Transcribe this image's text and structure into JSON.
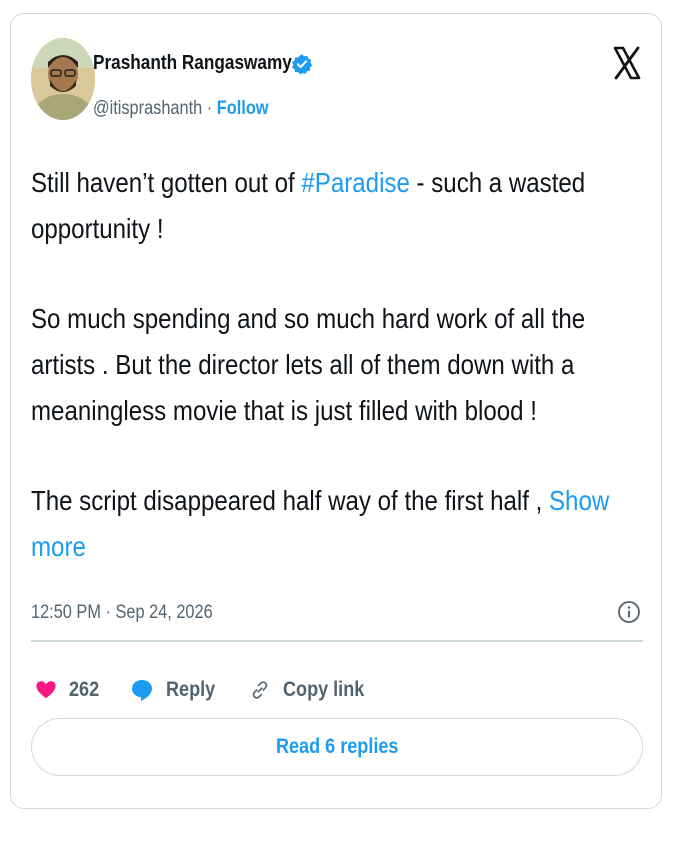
{
  "author": {
    "name": "Prashanth Rangaswamy",
    "handle": "@itisprashanth",
    "separator": "·",
    "follow_label": "Follow",
    "verified": true
  },
  "tweet": {
    "line1_pre": "Still haven’t gotten out of ",
    "line1_hashtag": "#Paradise",
    "line1_post": " - such a wasted",
    "line2": "opportunity !",
    "para2_line1": "So much spending and so much hard work of all the",
    "para2_line2": "artists . But the director lets all of them down with a",
    "para2_line3": "meaningless movie that is just filled with blood !",
    "para3_line1": "The script disappeared half way of the first half , ",
    "show_more_part1": "Show",
    "show_more_part2": "more",
    "timestamp": "12:50 PM · Sep 24, 2026"
  },
  "actions": {
    "like_count": "262",
    "reply_label": "Reply",
    "copy_link_label": "Copy link"
  },
  "read_replies_label": "Read 6 replies",
  "colors": {
    "accent": "#1d9bf0",
    "like": "#f91880",
    "muted": "#536471",
    "border": "#cfd9de"
  },
  "icons": {
    "brand": "x-logo-icon",
    "verified": "verified-badge-icon",
    "info": "info-icon",
    "like": "heart-icon",
    "reply": "speech-bubble-icon",
    "copy": "link-icon"
  }
}
